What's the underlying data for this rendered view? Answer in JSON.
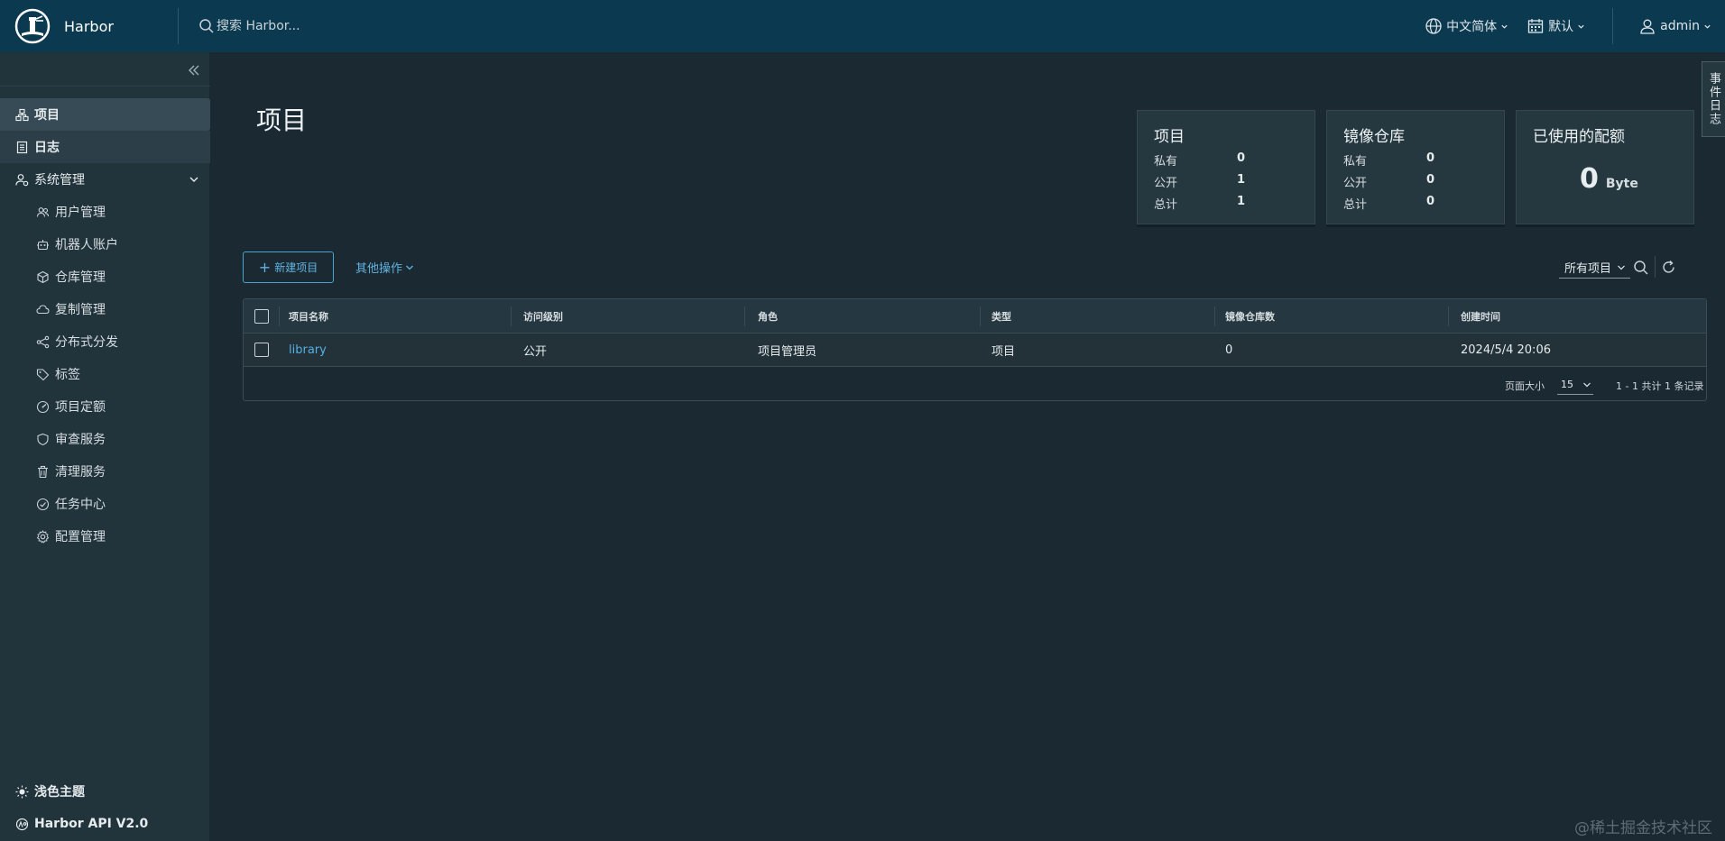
{
  "header": {
    "app_name": "Harbor",
    "search_placeholder": "搜索 Harbor...",
    "language": "中文简体",
    "date_format": "默认",
    "user": "admin"
  },
  "sidebar": {
    "items": [
      {
        "label": "项目",
        "icon": "projects-icon"
      },
      {
        "label": "日志",
        "icon": "logs-icon"
      },
      {
        "label": "系统管理",
        "icon": "admin-icon"
      }
    ],
    "sub_items": [
      {
        "label": "用户管理",
        "icon": "users-icon"
      },
      {
        "label": "机器人账户",
        "icon": "robot-icon"
      },
      {
        "label": "仓库管理",
        "icon": "registry-icon"
      },
      {
        "label": "复制管理",
        "icon": "replication-icon"
      },
      {
        "label": "分布式分发",
        "icon": "distribution-icon"
      },
      {
        "label": "标签",
        "icon": "tag-icon"
      },
      {
        "label": "项目定额",
        "icon": "quota-icon"
      },
      {
        "label": "审查服务",
        "icon": "shield-icon"
      },
      {
        "label": "清理服务",
        "icon": "trash-icon"
      },
      {
        "label": "任务中心",
        "icon": "task-icon"
      },
      {
        "label": "配置管理",
        "icon": "gear-icon"
      }
    ],
    "theme_toggle": "浅色主题",
    "api_link": "Harbor API V2.0"
  },
  "main": {
    "title": "项目",
    "cards": {
      "projects": {
        "title": "项目",
        "rows": [
          {
            "label": "私有",
            "value": "0"
          },
          {
            "label": "公开",
            "value": "1"
          },
          {
            "label": "总计",
            "value": "1"
          }
        ]
      },
      "repos": {
        "title": "镜像仓库",
        "rows": [
          {
            "label": "私有",
            "value": "0"
          },
          {
            "label": "公开",
            "value": "0"
          },
          {
            "label": "总计",
            "value": "0"
          }
        ]
      },
      "quota": {
        "title": "已使用的配额",
        "value": "0",
        "unit": "Byte"
      }
    },
    "toolbar": {
      "new_project": "新建项目",
      "other_actions": "其他操作",
      "filter": "所有项目"
    },
    "table": {
      "columns": [
        "项目名称",
        "访问级别",
        "角色",
        "类型",
        "镜像仓库数",
        "创建时间"
      ],
      "rows": [
        [
          "library",
          "公开",
          "项目管理员",
          "项目",
          "0",
          "2024/5/4 20:06"
        ]
      ],
      "page_size_label": "页面大小",
      "page_size": "15",
      "summary": "1 - 1 共计 1 条记录"
    },
    "side_tab": "事件日志"
  },
  "watermark": "@稀土掘金技术社区",
  "colors": {
    "header_bg": "#0b3a50",
    "sidebar_bg": "#21333b",
    "main_bg": "#1b2a32",
    "accent": "#56aee3"
  }
}
